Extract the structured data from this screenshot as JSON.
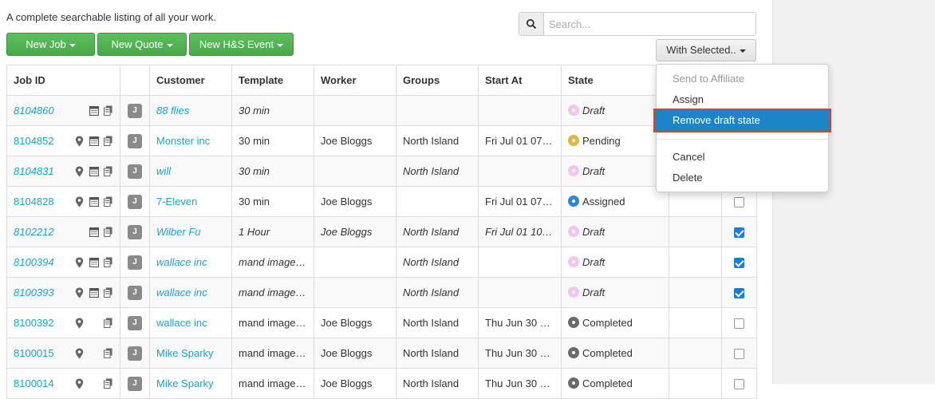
{
  "intro": "A complete searchable listing of all your work.",
  "buttons": {
    "new_job": "New Job",
    "new_quote": "New Quote",
    "new_hs_event": "New H&S Event",
    "with_selected": "With Selected.."
  },
  "search": {
    "placeholder": "Search...",
    "value": ""
  },
  "columns": [
    "Job ID",
    "",
    "Customer",
    "Template",
    "Worker",
    "Groups",
    "Start At",
    "State",
    "",
    ""
  ],
  "rows": [
    {
      "id": "8104860",
      "type": "J",
      "customer": "88 flies",
      "template": "30 min",
      "worker": "",
      "groups": "",
      "start": "",
      "state": "Draft",
      "checked": false
    },
    {
      "id": "8104852",
      "type": "J",
      "customer": "Monster inc",
      "template": "30 min",
      "worker": "Joe Bloggs",
      "groups": "North Island",
      "start": "Fri Jul 01 07:…",
      "state": "Pending",
      "checked": false
    },
    {
      "id": "8104831",
      "type": "J",
      "customer": "will",
      "template": "30 min",
      "worker": "",
      "groups": "North Island",
      "start": "",
      "state": "Draft",
      "checked": false
    },
    {
      "id": "8104828",
      "type": "J",
      "customer": "7-Eleven",
      "template": "30 min",
      "worker": "Joe Bloggs",
      "groups": "",
      "start": "Fri Jul 01 07:…",
      "state": "Assigned",
      "checked": false
    },
    {
      "id": "8102212",
      "type": "J",
      "customer": "Wilber Fu",
      "template": "1 Hour",
      "worker": "Joe Bloggs",
      "groups": "North Island",
      "start": "Fri Jul 01 10:…",
      "state": "Draft",
      "checked": true
    },
    {
      "id": "8100394",
      "type": "J",
      "customer": "wallace inc",
      "template": "mand image…",
      "worker": "",
      "groups": "North Island",
      "start": "",
      "state": "Draft",
      "checked": true
    },
    {
      "id": "8100393",
      "type": "J",
      "customer": "wallace inc",
      "template": "mand image…",
      "worker": "",
      "groups": "North Island",
      "start": "",
      "state": "Draft",
      "checked": true
    },
    {
      "id": "8100392",
      "type": "J",
      "customer": "wallace inc",
      "template": "mand image…",
      "worker": "Joe Bloggs",
      "groups": "North Island",
      "start": "Thu Jun 30 1…",
      "state": "Completed",
      "checked": false
    },
    {
      "id": "8100015",
      "type": "J",
      "customer": "Mike Sparky",
      "template": "mand image…",
      "worker": "Joe Bloggs",
      "groups": "North Island",
      "start": "Thu Jun 30 1…",
      "state": "Completed",
      "checked": false
    },
    {
      "id": "8100014",
      "type": "J",
      "customer": "Mike Sparky",
      "template": "mand image…",
      "worker": "Joe Bloggs",
      "groups": "North Island",
      "start": "Thu Jun 30 1…",
      "state": "Completed",
      "checked": false
    }
  ],
  "row_icons": [
    {
      "pin": false,
      "calendar": true,
      "copy": true
    },
    {
      "pin": true,
      "calendar": true,
      "copy": true
    },
    {
      "pin": true,
      "calendar": true,
      "copy": true
    },
    {
      "pin": true,
      "calendar": true,
      "copy": true
    },
    {
      "pin": false,
      "calendar": true,
      "copy": true
    },
    {
      "pin": true,
      "calendar": true,
      "copy": true
    },
    {
      "pin": true,
      "calendar": true,
      "copy": true
    },
    {
      "pin": true,
      "calendar": false,
      "copy": true
    },
    {
      "pin": true,
      "calendar": false,
      "copy": true
    },
    {
      "pin": true,
      "calendar": false,
      "copy": true
    }
  ],
  "state_colors": {
    "Draft": "#f4c6ee",
    "Pending": "#e3b64a",
    "Assigned": "#2e86d4",
    "Completed": "#6a6a6a"
  },
  "dropdown": {
    "items": [
      {
        "label": "Send to Affiliate",
        "disabled": true
      },
      {
        "label": "Assign"
      },
      {
        "label": "Remove draft state",
        "highlighted": true
      },
      {
        "divider": true
      },
      {
        "label": "Cancel"
      },
      {
        "label": "Delete"
      }
    ]
  },
  "colors": {
    "accent_green": "#4cae4c",
    "link": "#1aa3cf",
    "highlight": "#1c85c7",
    "highlight_border": "#e8392a"
  }
}
